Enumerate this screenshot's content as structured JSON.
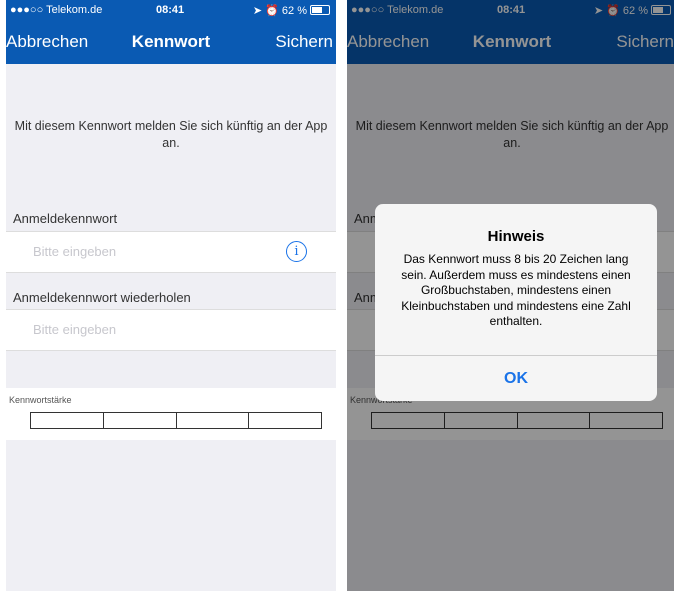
{
  "status": {
    "carrier": "●●●○○ Telekom.de",
    "wifi_icon": "wifi-icon",
    "time": "08:41",
    "battery": "62 %"
  },
  "nav": {
    "cancel_label": "Abbrechen",
    "title": "Kennwort",
    "save_label": "Sichern"
  },
  "intro_text": "Mit diesem Kennwort melden Sie sich künftig an der App an.",
  "fields": {
    "password_label": "Anmeldekennwort",
    "password_placeholder": "Bitte eingeben",
    "repeat_label": "Anmeldekennwort wiederholen",
    "repeat_placeholder": "Bitte eingeben"
  },
  "strength": {
    "label": "Kennwortstärke",
    "segments": 4,
    "filled": 0
  },
  "dialog": {
    "title": "Hinweis",
    "message": "Das Kennwort muss 8 bis 20 Zeichen lang sein. Außerdem muss es mindestens einen Großbuchstaben, mindestens einen Kleinbuchstaben und mindestens eine Zahl enthalten.",
    "ok_label": "OK"
  },
  "colors": {
    "nav_blue": "#0a5ab3",
    "accent": "#1a73e8",
    "background": "#efeff4"
  }
}
